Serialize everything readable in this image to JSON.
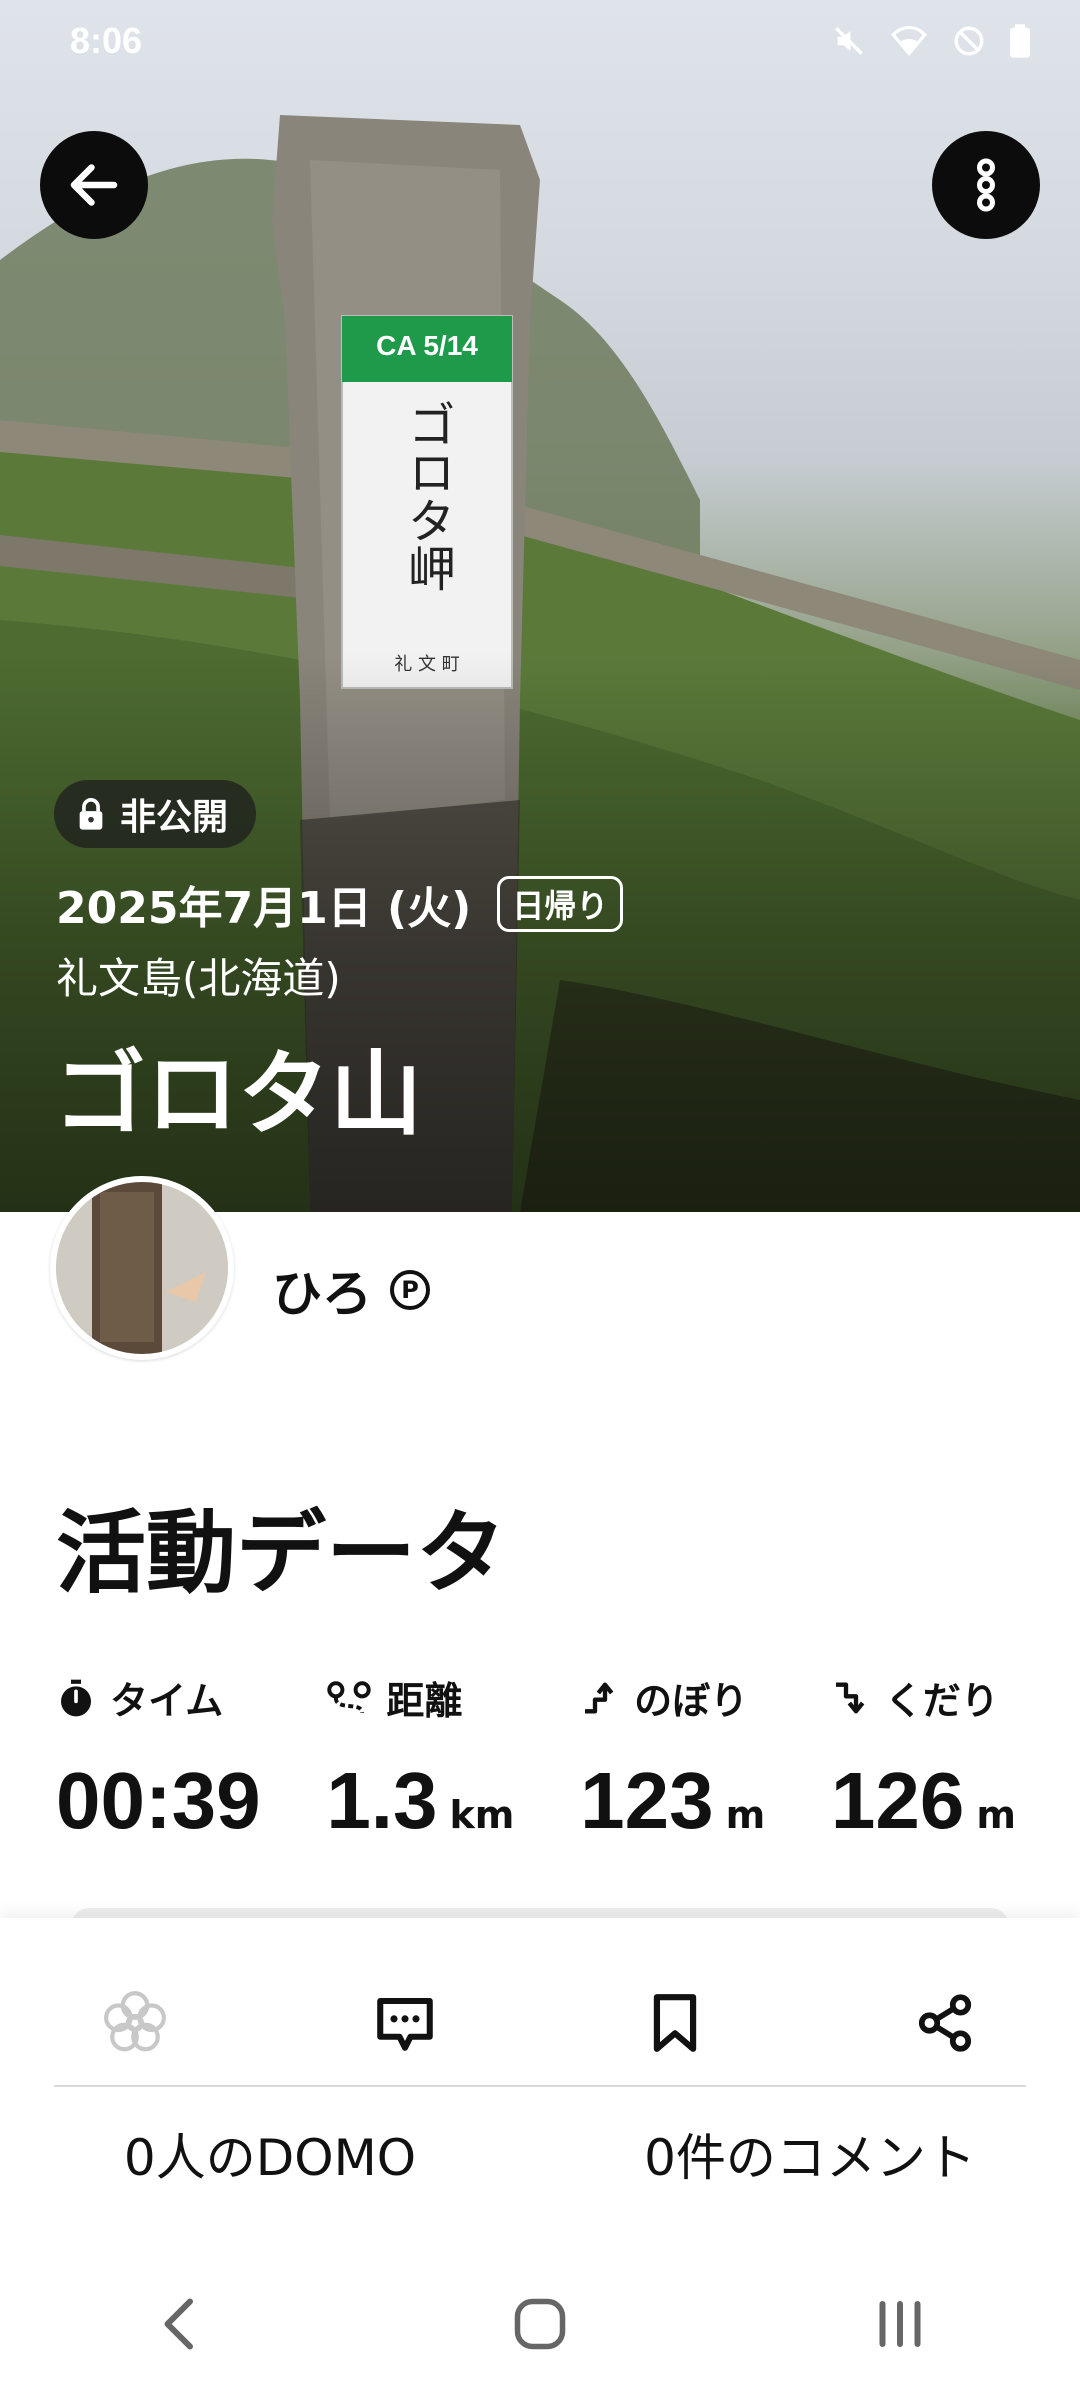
{
  "status_bar": {
    "time": "8:06"
  },
  "header": {
    "back_icon": "arrow-left-icon",
    "more_icon": "more-vertical-icon"
  },
  "hero": {
    "privacy_icon": "lock-icon",
    "privacy_label": "非公開",
    "date": "2025年7月1日 (火)",
    "trip_type": "日帰り",
    "location": "礼文島(北海道)",
    "mountain_name": "ゴロタ山",
    "sign": {
      "code": "CA 5/14",
      "name": "ゴロタ岬",
      "town": "礼 文 町"
    }
  },
  "user": {
    "name": "ひろ",
    "badge": "P"
  },
  "activity": {
    "title": "活動データ",
    "stats": [
      {
        "icon": "stopwatch-icon",
        "label": "タイム",
        "value": "00:39",
        "unit": ""
      },
      {
        "icon": "route-icon",
        "label": "距離",
        "value": "1.3",
        "unit": "km"
      },
      {
        "icon": "ascent-icon",
        "label": "のぼり",
        "value": "123",
        "unit": "m"
      },
      {
        "icon": "descent-icon",
        "label": "くだり",
        "value": "126",
        "unit": "m"
      }
    ]
  },
  "actions": {
    "domo_icon": "domo-flower-icon",
    "comment_icon": "comment-icon",
    "bookmark_icon": "bookmark-icon",
    "share_icon": "share-icon",
    "domo_count": "0人のDOMO",
    "comment_count": "0件のコメント"
  },
  "nav": {
    "back_icon": "nav-back-icon",
    "home_icon": "nav-home-icon",
    "recents_icon": "nav-recents-icon"
  },
  "colors": {
    "sign_green": "#1e9a4a",
    "text_dark": "#111111",
    "domo_inactive": "#c8c8c8"
  }
}
